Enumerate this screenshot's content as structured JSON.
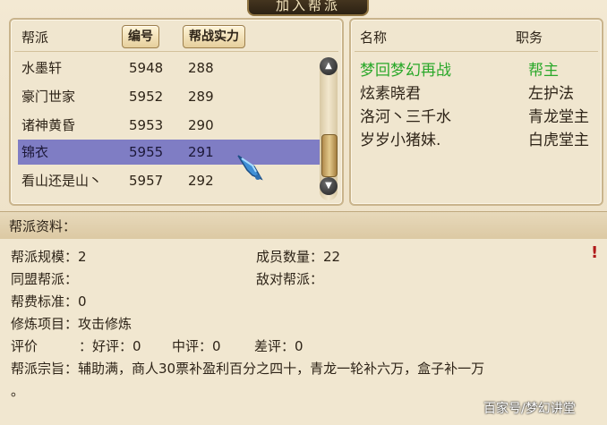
{
  "window": {
    "title": "加入帮派"
  },
  "list": {
    "headers": {
      "name": "帮派",
      "id": "编号",
      "power": "帮战实力"
    },
    "rows": [
      {
        "name": "水墨轩",
        "id": "5948",
        "power": "288"
      },
      {
        "name": "豪门世家",
        "id": "5952",
        "power": "289"
      },
      {
        "name": "诸神黄昏",
        "id": "5953",
        "power": "290"
      },
      {
        "name": "锦衣",
        "id": "5955",
        "power": "291"
      },
      {
        "name": "看山还是山丶",
        "id": "5957",
        "power": "292"
      }
    ],
    "selected_index": 3
  },
  "members": {
    "headers": {
      "name": "名称",
      "role": "职务"
    },
    "rows": [
      {
        "name": "梦回梦幻再战",
        "role": "帮主"
      },
      {
        "name": "炫素晓君",
        "role": "左护法"
      },
      {
        "name": "洛河丶三千水",
        "role": "青龙堂主"
      },
      {
        "name": "岁岁小猪妹.",
        "role": "白虎堂主"
      }
    ]
  },
  "info": {
    "section_title": "帮派资料：",
    "scale_label": "帮派规模：2",
    "members_label": "成员数量：22",
    "ally_label": "同盟帮派：",
    "enemy_label": "敌对帮派：",
    "fee_label": "帮费标准：0",
    "cultivation_label": "修炼项目：攻击修炼",
    "rating_label": "评价",
    "good_label": "：好评：0",
    "mid_label": "中评：0",
    "bad_label": "差评：0",
    "purpose_label": "帮派宗旨：辅助满，商人30票补盈利百分之四十，青龙一轮补六万，盒子补一万",
    "purpose_cont": "。",
    "warning": "!"
  },
  "watermark": "百家号/梦幻讲堂",
  "colors": {
    "selected_row": "#7f7dc4",
    "leader": "#2aa82a"
  },
  "icons": {
    "scroll_up": "triangle-up-icon",
    "scroll_down": "triangle-down-icon",
    "cursor": "hand-cursor-icon"
  }
}
